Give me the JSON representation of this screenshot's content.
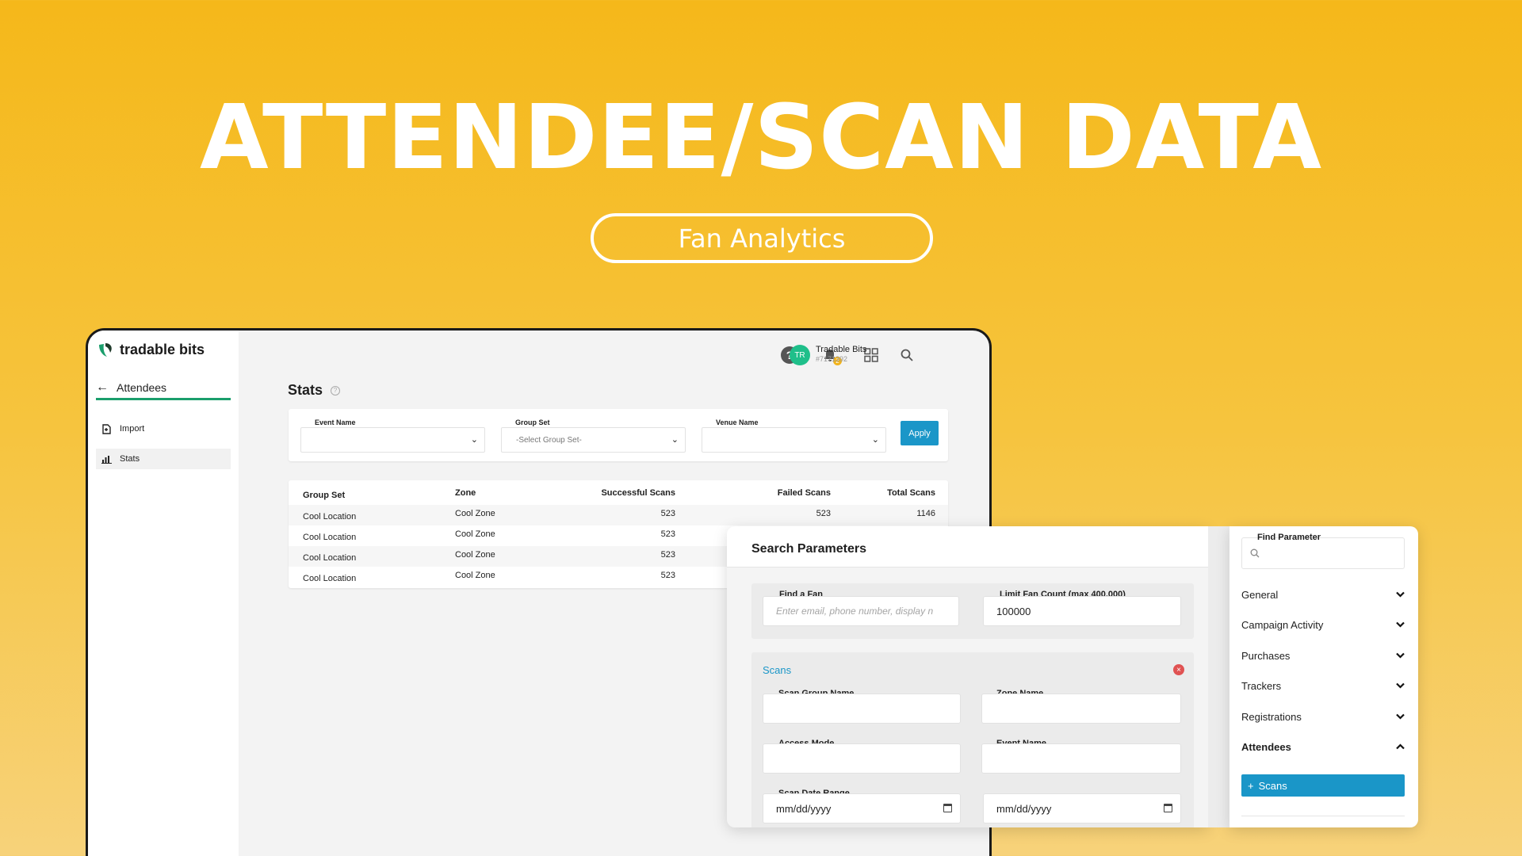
{
  "hero": {
    "title": "ATTENDEE/SCAN DATA",
    "pill": "Fan Analytics"
  },
  "app": {
    "logo_text": "tradable bits",
    "back_label": "Attendees",
    "sidebar": [
      {
        "label": "Import",
        "icon": "import-file-icon"
      },
      {
        "label": "Stats",
        "icon": "bar-chart-icon"
      }
    ],
    "topbar": {
      "help": "?",
      "bell_badge": "2",
      "user_initials": "TR",
      "user_name": "Tradable Bits",
      "user_id": "#7171392"
    },
    "stats_title": "Stats",
    "filters": {
      "event_label": "Event Name",
      "event_value": "",
      "group_label": "Group Set",
      "group_value": "-Select Group Set-",
      "venue_label": "Venue Name",
      "venue_value": "",
      "apply": "Apply"
    },
    "table": {
      "headers": [
        "Group Set",
        "Zone",
        "Successful Scans",
        "Failed Scans",
        "Total Scans"
      ],
      "rows": [
        [
          "Cool Location",
          "Cool Zone",
          "523",
          "523",
          "1146"
        ],
        [
          "Cool Location",
          "Cool Zone",
          "523",
          "",
          ""
        ],
        [
          "Cool Location",
          "Cool Zone",
          "523",
          "",
          ""
        ],
        [
          "Cool Location",
          "Cool Zone",
          "523",
          "",
          ""
        ]
      ]
    }
  },
  "search": {
    "title": "Search Parameters",
    "find_fan_label": "Find a Fan",
    "find_fan_placeholder": "Enter email, phone number, display n",
    "limit_label": "Limit Fan Count (max 400,000)",
    "limit_value": "100000",
    "scans_title": "Scans",
    "scan_group_label": "Scan Group Name",
    "zone_label": "Zone Name",
    "access_label": "Access Mode",
    "event_label": "Event Name",
    "date_label": "Scan Date Range",
    "date_from": "mm/dd/yyyy",
    "date_to": "mm/dd/yyyy",
    "dash": "—"
  },
  "params": {
    "find_label": "Find Parameter",
    "items": [
      {
        "label": "General",
        "state": "collapsed"
      },
      {
        "label": "Campaign Activity",
        "state": "collapsed"
      },
      {
        "label": "Purchases",
        "state": "collapsed"
      },
      {
        "label": "Trackers",
        "state": "collapsed"
      },
      {
        "label": "Registrations",
        "state": "collapsed"
      },
      {
        "label": "Attendees",
        "state": "expanded"
      }
    ],
    "scans_button": "Scans",
    "plus": "+"
  },
  "colors": {
    "accent": "#1a96c8",
    "brand_green": "#1a9e6c",
    "background": "#f5b81a"
  }
}
